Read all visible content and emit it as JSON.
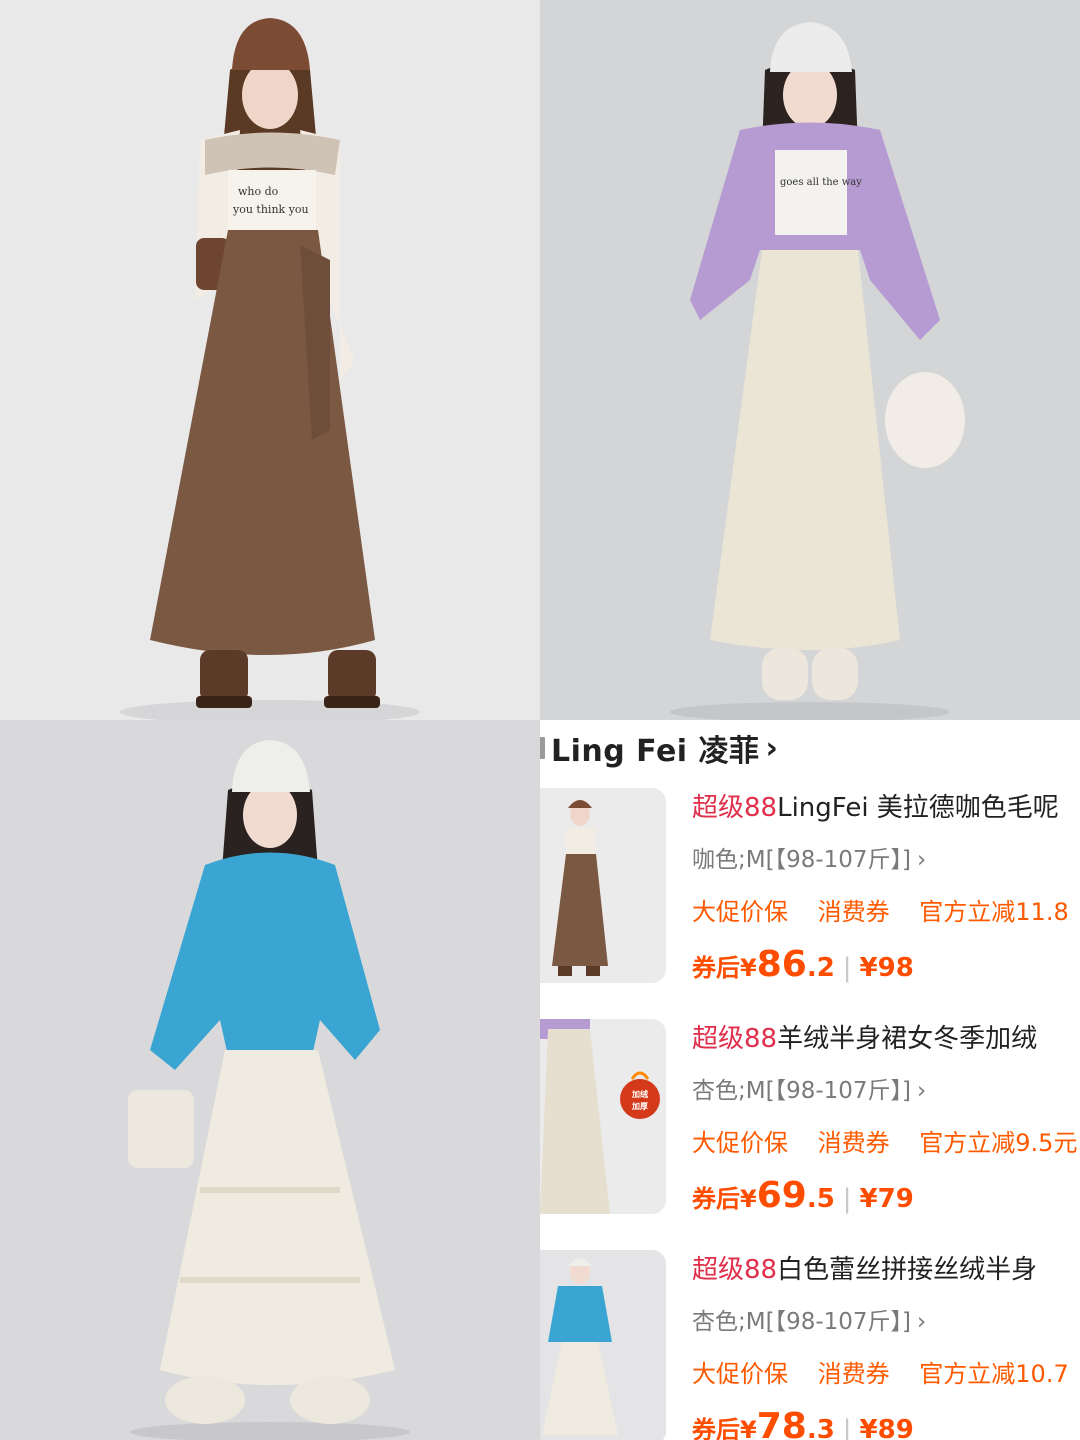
{
  "shop": {
    "name": "Ling Fei 凌菲",
    "chevron": "›"
  },
  "items": [
    {
      "tag": "超级88",
      "title": "LingFei 美拉德咖色毛呢",
      "spec": "咖色;M[【98-107斤】]",
      "spec_arrow": "›",
      "promos": [
        "大促价保",
        "消费券",
        "官方立减11.8"
      ],
      "price_label": "券后¥",
      "price_int": "86",
      "price_dec": ".2",
      "original_price": "¥98"
    },
    {
      "tag": "超级88",
      "title": "羊绒半身裙女冬季加绒",
      "spec": "杏色;M[【98-107斤】]",
      "spec_arrow": "›",
      "promos": [
        "大促价保",
        "消费券",
        "官方立减9.5元"
      ],
      "price_label": "券后¥",
      "price_int": "69",
      "price_dec": ".5",
      "original_price": "¥79",
      "badge": "加绒加厚"
    },
    {
      "tag": "超级88",
      "title": "白色蕾丝拼接丝绒半身",
      "spec": "杏色;M[【98-107斤】]",
      "spec_arrow": "›",
      "promos": [
        "大促价保",
        "消费券",
        "官方立减10.7"
      ],
      "price_label": "券后¥",
      "price_int": "78",
      "price_dec": ".3",
      "original_price": "¥89"
    }
  ],
  "colors": {
    "accent": "#ff4d00",
    "tag": "#e02e4b",
    "promo": "#ff5a00"
  }
}
